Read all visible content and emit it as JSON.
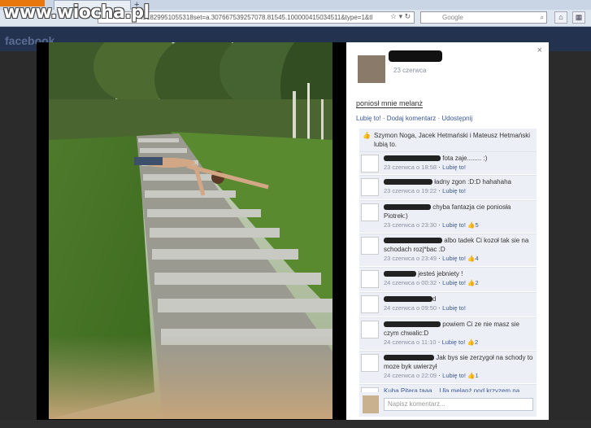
{
  "watermark": "www.wiocha.pl",
  "browser": {
    "url": "491829951055318set=a.307667539257078.81545.100000415034511&type=1&tl",
    "search_placeholder": "Google",
    "fb_logo": "facebook"
  },
  "post": {
    "date": "23 czerwca",
    "caption": "poniosl mnie melanż",
    "caption_display": "poniosł mnie melanż",
    "actions": "Lubię to! · Dodaj komentarz · Udostępnij",
    "likes_text": "Szymon Noga, Jacek Hetmański i Mateusz Hetmański lubią to."
  },
  "comments": [
    {
      "text": "fota zaje........ :)",
      "meta": "23 czerwca o 18:58",
      "like": "Lubię to!",
      "count": ""
    },
    {
      "text": "ładny zgon :D:D hahahaha",
      "meta": "23 czerwca o 19:22",
      "like": "Lubię to!",
      "count": ""
    },
    {
      "text": "chyba fantazja cie poniosła Piotrek:)",
      "meta": "23 czerwca o 23:30",
      "like": "Lubię to!",
      "count": "5"
    },
    {
      "text": "albo tadek Ci kozoł tak sie na schodach rozj*bac :D",
      "meta": "23 czerwca o 23:49",
      "like": "Lubię to!",
      "count": "4"
    },
    {
      "text": "jesteś jebniety !",
      "meta": "24 czerwca o 00:32",
      "like": "Lubię to!",
      "count": "2"
    },
    {
      "text": "d",
      "meta": "24 czerwca o 09:50",
      "like": "Lubię to!",
      "count": ""
    },
    {
      "text": "powiem Ci ze nie masz sie czym chwalic:D",
      "meta": "24 czerwca o 11:10",
      "like": "Lubię to!",
      "count": "2"
    },
    {
      "text": "Jak bys sie zerzygoł na schody to moze byk uwierzył",
      "meta": "24 czerwca o 22:09",
      "like": "Lubię to!",
      "count": "1"
    },
    {
      "text": "Kuba Pitera taaa... Ula melanż pod krzyzem na",
      "meta": "",
      "like": "",
      "count": ""
    }
  ],
  "comment_placeholder": "Napisz komentarz...",
  "close_label": "×"
}
